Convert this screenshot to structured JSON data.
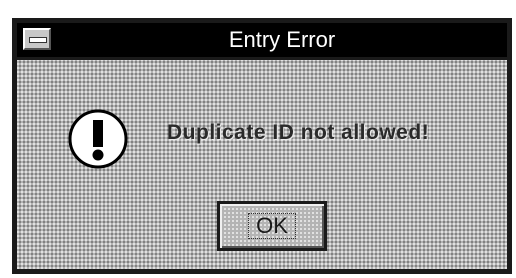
{
  "window": {
    "title": "Entry Error"
  },
  "icons": {
    "sysmenu": "system-menu-icon",
    "alert": "exclamation-icon"
  },
  "dialog": {
    "message": "Duplicate ID not allowed!",
    "ok_label": "OK"
  },
  "colors": {
    "titlebar": "#000000",
    "title_text": "#ffffff",
    "dialog_background": "#b4b4b4",
    "border": "#1a1a1a"
  }
}
